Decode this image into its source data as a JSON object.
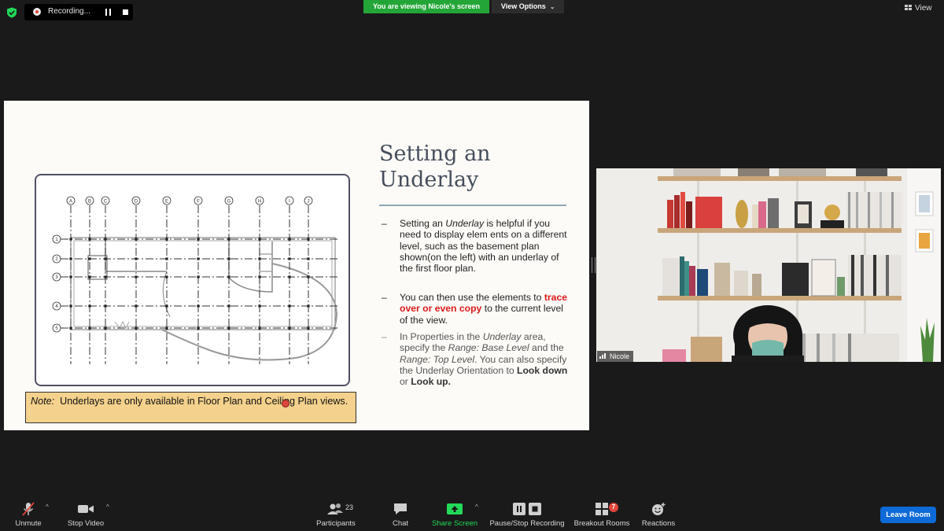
{
  "top_bar": {
    "recording_label": "Recording...",
    "viewing_banner": "You are viewing Nicole's screen",
    "view_options_label": "View Options",
    "view_label": "View"
  },
  "slide": {
    "title_line1": "Setting an",
    "title_line2": "Underlay",
    "bullet_dash": "–",
    "bullet1": {
      "p1": "Setting an ",
      "em1": "Underlay",
      "p2": " is helpful if you need to display elem ents on a different level, such as the basement plan shown(on the left) with an underlay of the first floor plan."
    },
    "bullet2": {
      "p1": "You can then use the elements to ",
      "red": "trace over or even copy",
      "p2": " to the current level of the view."
    },
    "bullet3": {
      "p1": "In Properties in the ",
      "em1": "Underlay",
      "p2": " area, specify the ",
      "em2": "Range: Base Level",
      "p3": " and the ",
      "em3": "Range: Top Level",
      "p4": ". You can also specify the Underlay Orientation to ",
      "b1": "Look down",
      "p5": " or ",
      "b2": "Look up."
    },
    "note": {
      "label": "Note:",
      "text": "  Underlays are only available in Floor Plan and Ceiling Plan views."
    },
    "grid_letters": [
      "A",
      "B",
      "C",
      "D",
      "E",
      "F",
      "G",
      "H",
      "I",
      "J"
    ],
    "grid_numbers": [
      "1",
      "2",
      "3",
      "4",
      "5"
    ]
  },
  "video": {
    "participant_name": "Nicole"
  },
  "toolbar": {
    "unmute_label": "Unmute",
    "stop_video_label": "Stop Video",
    "participants_label": "Participants",
    "participants_count": "23",
    "chat_label": "Chat",
    "share_screen_label": "Share Screen",
    "pause_stop_recording_label": "Pause/Stop Recording",
    "breakout_rooms_label": "Breakout Rooms",
    "breakout_badge": "7",
    "reactions_label": "Reactions",
    "leave_room_label": "Leave Room"
  },
  "colors": {
    "banner_green": "#23a637",
    "share_green": "#23d959",
    "leave_blue": "#0e6ad7",
    "recording_red": "#e0463b",
    "slide_title": "#464e5c",
    "emphasis_red": "#d91a1a",
    "note_bg": "#f4d18c"
  }
}
